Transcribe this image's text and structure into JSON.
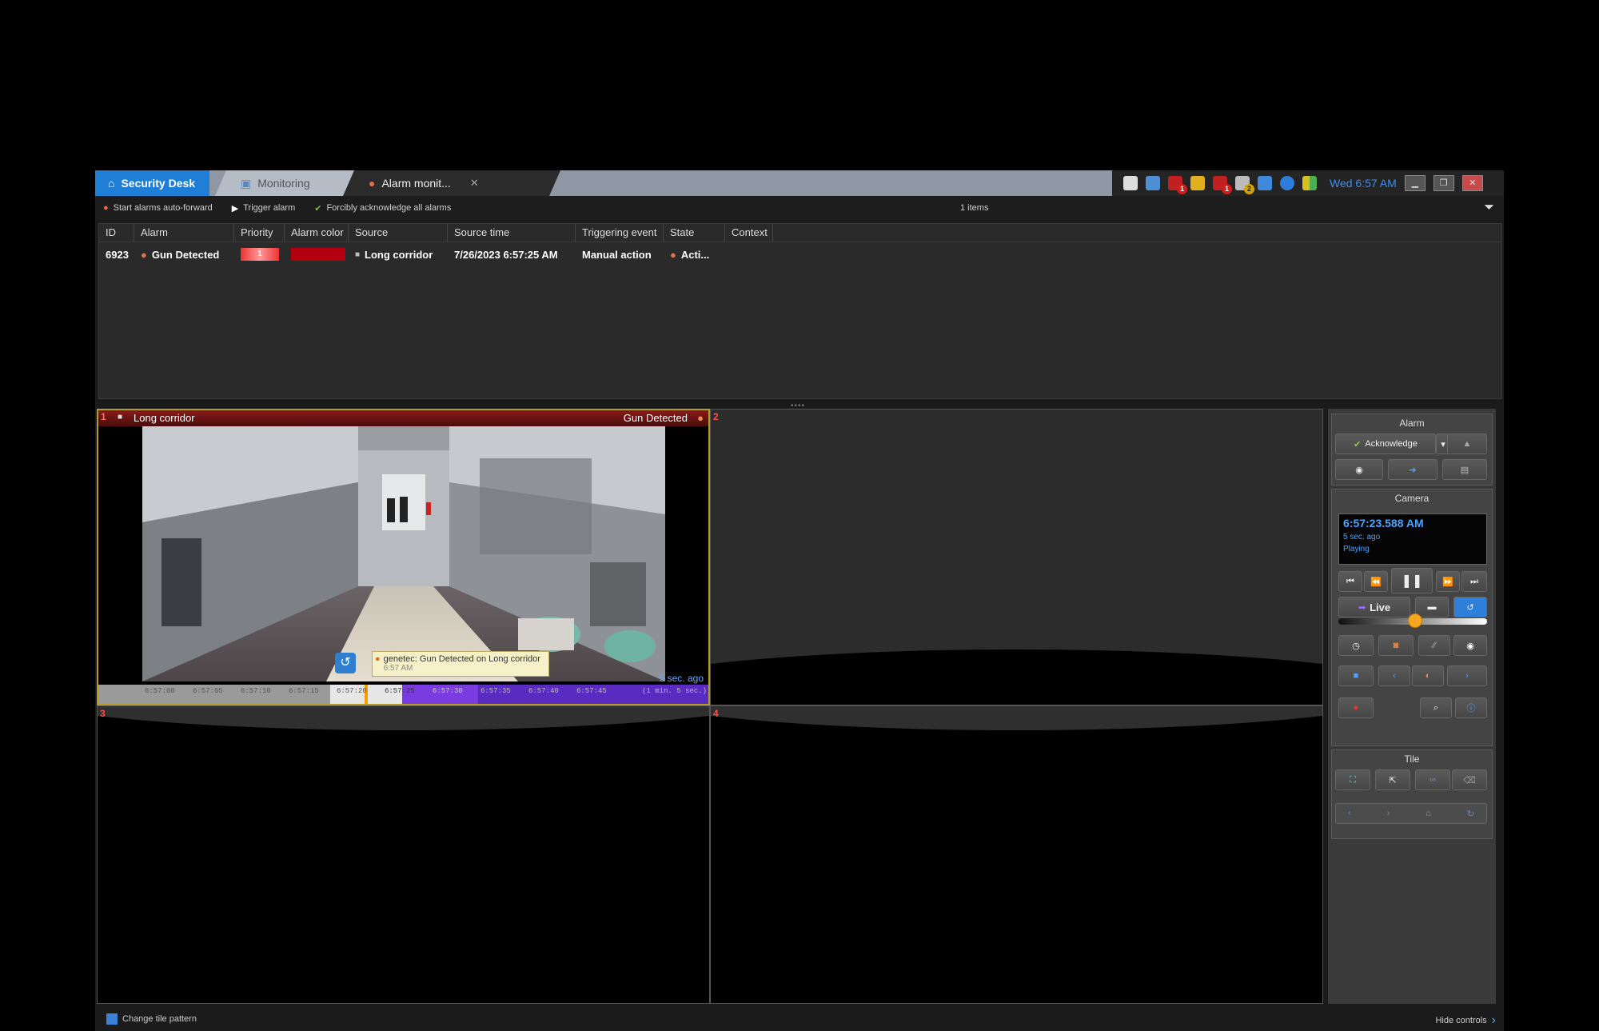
{
  "tabs": {
    "home_label": "Security Desk",
    "monitoring_label": "Monitoring",
    "alarm_label": "Alarm monit...",
    "close_glyph": "✕"
  },
  "tray": {
    "badges": [
      "1",
      "1",
      "2"
    ],
    "clock": "Wed 6:57 AM"
  },
  "toolbar": {
    "auto_forward": "Start alarms auto-forward",
    "trigger": "Trigger alarm",
    "acknowledge_all": "Forcibly acknowledge all alarms",
    "count": "1 items"
  },
  "table": {
    "columns": [
      "ID",
      "Alarm",
      "Priority",
      "Alarm color",
      "Source",
      "Source time",
      "Triggering event",
      "State",
      "Context"
    ],
    "rows": [
      {
        "id": "6923",
        "alarm": "Gun Detected",
        "priority": "1",
        "alarm_color": "#b3000f",
        "source": "Long corridor",
        "source_time": "7/26/2023 6:57:25 AM",
        "triggering_event": "Manual action",
        "state": "Acti...",
        "context": ""
      }
    ]
  },
  "tiles": {
    "t1": {
      "number": "1",
      "source": "Long corridor",
      "alarm": "Gun Detected",
      "ago": "5 sec. ago"
    },
    "t2": {
      "number": "2"
    },
    "t3": {
      "number": "3"
    },
    "t4": {
      "number": "4"
    },
    "timeline_labels": [
      "6:57:00",
      "6:57:05",
      "6:57:10",
      "6:57:15",
      "6:57:20",
      "6:57:25",
      "6:57:30",
      "6:57:35",
      "6:57:40",
      "6:57:45",
      "(1 min. 5 sec.)"
    ],
    "tooltip_title": "genetec: Gun Detected on Long corridor",
    "tooltip_time": "6:57 AM"
  },
  "controls": {
    "alarm_title": "Alarm",
    "acknowledge": "Acknowledge",
    "camera_title": "Camera",
    "cam_time": "6:57:23.588 AM",
    "cam_ago": "5 sec. ago",
    "cam_state": "Playing",
    "live": "Live",
    "tile_title": "Tile"
  },
  "footer": {
    "change_pattern": "Change tile pattern",
    "hide_controls": "Hide controls"
  },
  "colors": {
    "accent": "#1f7fd6",
    "alarm_red": "#b3000f",
    "tile_border": "#b79a2c",
    "timeline_purple": "#6a2fd6"
  }
}
